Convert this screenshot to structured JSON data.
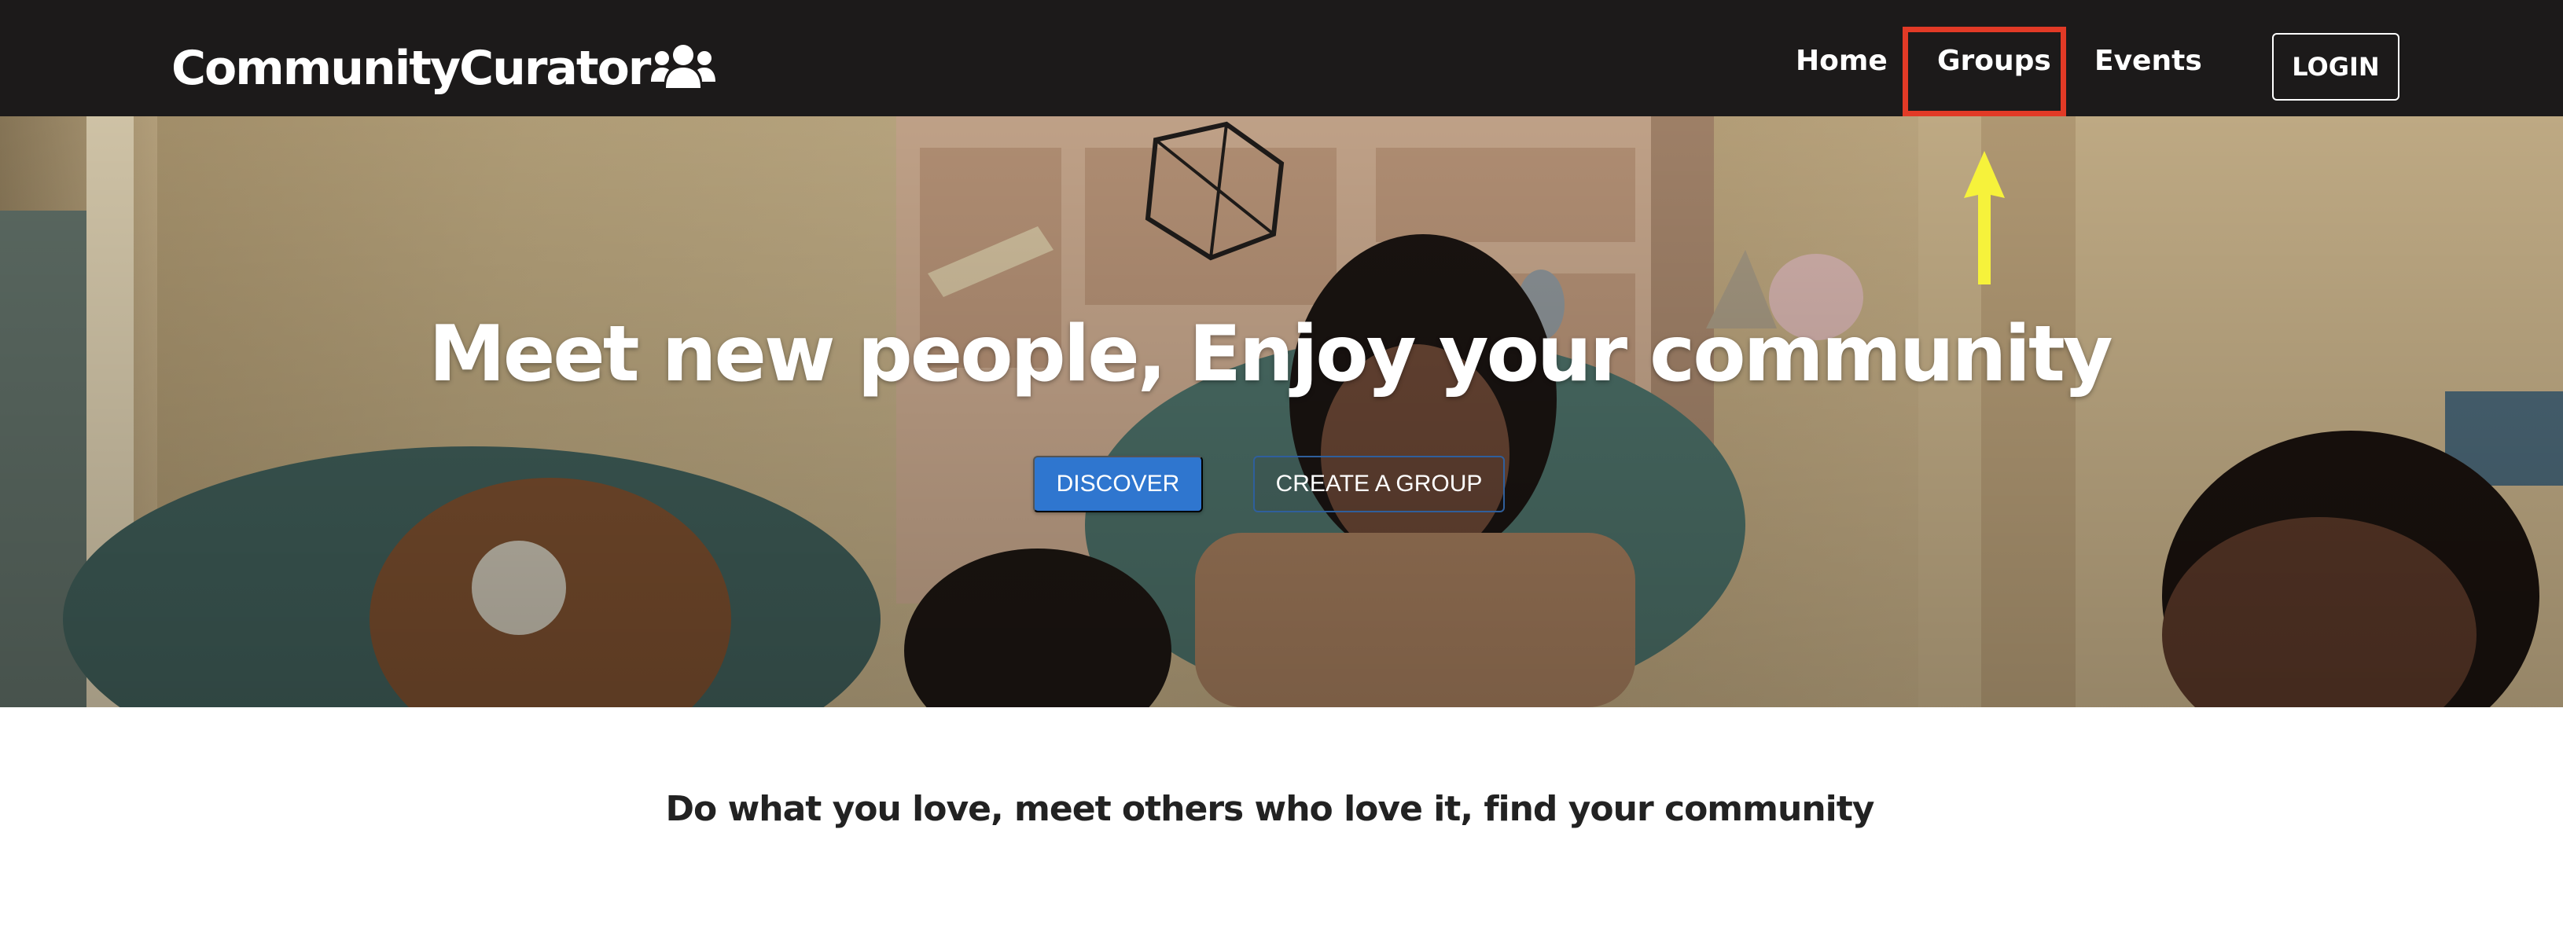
{
  "navbar": {
    "brand": "CommunityCurator",
    "brand_icon": "users-icon",
    "links": [
      {
        "label": "Home"
      },
      {
        "label": "Groups"
      },
      {
        "label": "Events"
      }
    ],
    "login_label": "LOGIN",
    "highlight_color": "#e23a26"
  },
  "hero": {
    "headline": "Meet new people, Enjoy your community",
    "discover_label": "DISCOVER",
    "create_group_label": "CREATE A GROUP",
    "arrow_color": "#f6f23b",
    "discover_color": "#2f76cf"
  },
  "tagline": "Do what you love, meet others who love it, find your community"
}
